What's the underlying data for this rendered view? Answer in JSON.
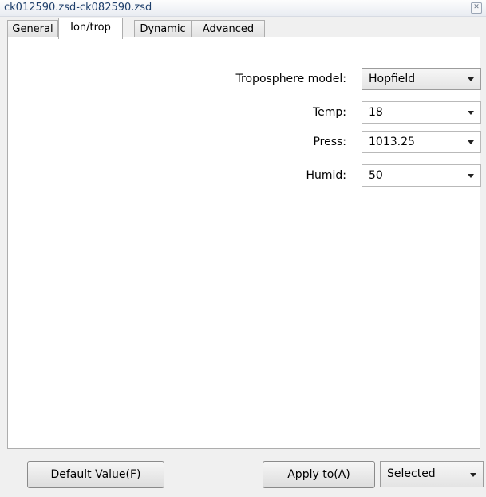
{
  "window": {
    "title": "ck012590.zsd-ck082590.zsd"
  },
  "tabs": [
    {
      "label": "General"
    },
    {
      "label": "Ion/trop"
    },
    {
      "label": "Dynamic"
    },
    {
      "label": "Advanced"
    }
  ],
  "active_tab": "Ion/trop",
  "form": {
    "troposphere_model": {
      "label": "Troposphere model:",
      "value": "Hopfield"
    },
    "temp": {
      "label": "Temp:",
      "value": "18"
    },
    "press": {
      "label": "Press:",
      "value": "1013.25"
    },
    "humid": {
      "label": "Humid:",
      "value": "50"
    }
  },
  "footer": {
    "default_button": "Default Value(F)",
    "apply_button": "Apply to(A)",
    "apply_target": "Selected"
  }
}
